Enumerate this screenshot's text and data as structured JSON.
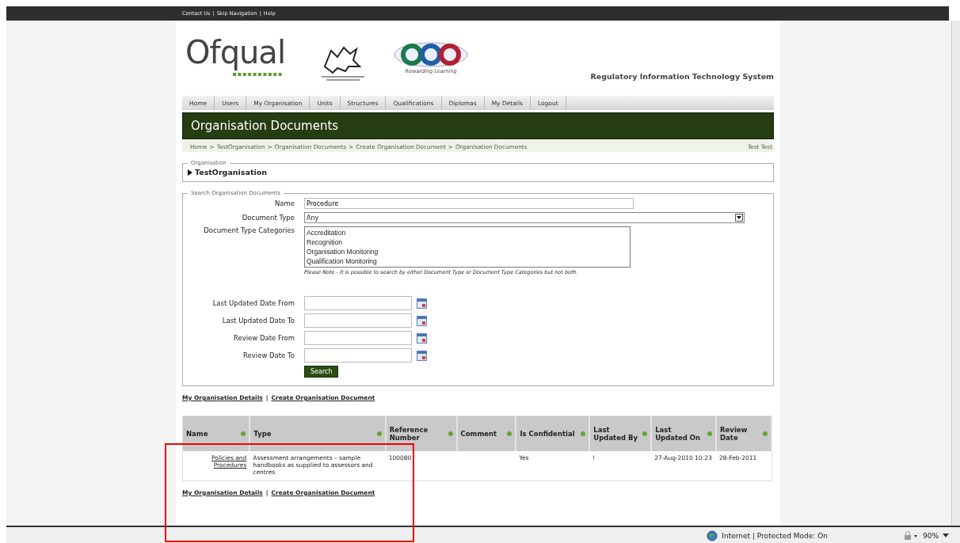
{
  "top_links": [
    "Contact Us",
    "Skip Navigation",
    "Help"
  ],
  "header": {
    "logo": "Ofqual",
    "partner_caption": "Rewarding Learning",
    "system_title": "Regulatory Information Technology System"
  },
  "nav": [
    "Home",
    "Users",
    "My Organisation",
    "Units",
    "Structures",
    "Qualifications",
    "Diplomas",
    "My Details",
    "Logout"
  ],
  "page_title": "Organisation Documents",
  "breadcrumb": [
    "Home",
    "TestOrganisation",
    "Organisation Documents",
    "Create Organisation Document",
    "Organisation Documents"
  ],
  "breadcrumb_separator": ">",
  "user": "Test Test",
  "organisation": {
    "legend": "Organisation",
    "name": "TestOrganisation",
    "expanded": false
  },
  "search": {
    "legend": "Search Organisation Documents",
    "fields": [
      {
        "kind": "text",
        "label": "Name",
        "value": "Procedure"
      },
      {
        "kind": "select",
        "label": "Document Type",
        "value": "Any"
      },
      {
        "kind": "listbox",
        "label": "Document Type Categories",
        "options": [
          "Accreditation",
          "Recognition",
          "Organisation Monitoring",
          "Qualification Monitoring"
        ],
        "note": "Please Note - It is possible to search by either Document Type or Document Type Categories but not both."
      },
      {
        "kind": "date",
        "label": "Last Updated Date From"
      },
      {
        "kind": "date",
        "label": "Last Updated Date To"
      },
      {
        "kind": "date",
        "label": "Review Date From"
      },
      {
        "kind": "date",
        "label": "Review Date To"
      }
    ],
    "button": "Search"
  },
  "link_separator": "|",
  "links_top": [
    "My Organisation Details",
    "Create Organisation Document"
  ],
  "table": {
    "columns": [
      "Name",
      "Type",
      "Reference Number",
      "Comment",
      "Is Confidential",
      "Last Updated By",
      "Last Updated On",
      "Review Date"
    ],
    "rows": [
      [
        "Policies and Procedures",
        "Assessment arrangements – sample handbooks as supplied to assessors and centres",
        "100080",
        "",
        "Yes",
        "!",
        "27-Aug-2010 10:23",
        "28-Feb-2011"
      ]
    ]
  },
  "links_bottom": [
    "My Organisation Details",
    "Create Organisation Document"
  ],
  "status_bar": {
    "zone": "Internet | Protected Mode: On",
    "zoom": "90%"
  }
}
